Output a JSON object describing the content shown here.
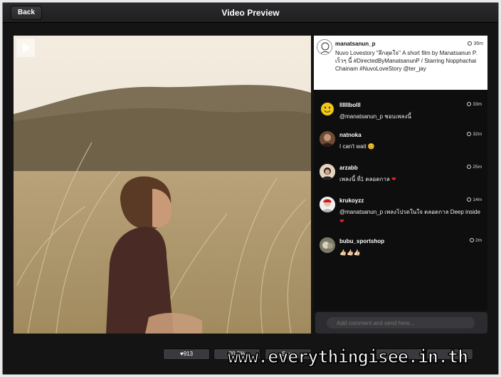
{
  "header": {
    "back_label": "Back",
    "title": "Video Preview"
  },
  "caption": {
    "user": "manatsanun_p",
    "time": "36m",
    "text": "Nuvo Lovestory \"ลึกสุดใจ\" A short film by Manatsanun P. เร็วๆ นี้ #DirectedByManatsanunP / Starring Nopphachai Chainam #NuvoLoveStory @ter_jay"
  },
  "comments": [
    {
      "user": "llllllbolll",
      "time": "33m",
      "text": "@manatsanun_p ชอบเพลงนี้",
      "avatar": "yellow-emoji-avatar"
    },
    {
      "user": "natnoka",
      "time": "32m",
      "text": "I can't wait 😊",
      "avatar": "photo-avatar"
    },
    {
      "user": "arzabb",
      "time": "25m",
      "text": "เพลงนี้ ที่1 ตลอดกาล",
      "avatar": "photo-avatar"
    },
    {
      "user": "krukoyzz",
      "time": "14m",
      "text": "@manatsanun_p เพลงโปรดในใจ ตลอดกาล Deep inside",
      "avatar": "photo-avatar"
    },
    {
      "user": "bubu_sportshop",
      "time": "2m",
      "text": "👍🏻👍🏻👍🏻",
      "avatar": "photo-avatar"
    }
  ],
  "comment_input": {
    "placeholder": "Add comment and send here..."
  },
  "toolbar": {
    "likes": "♥913",
    "btn2": "20.3%",
    "btn3": "Save"
  },
  "watermark": "www.everythingisee.in.th",
  "colors": {
    "heart": "#e0262b",
    "background": "#141414",
    "caption_bg": "#ffffff"
  }
}
